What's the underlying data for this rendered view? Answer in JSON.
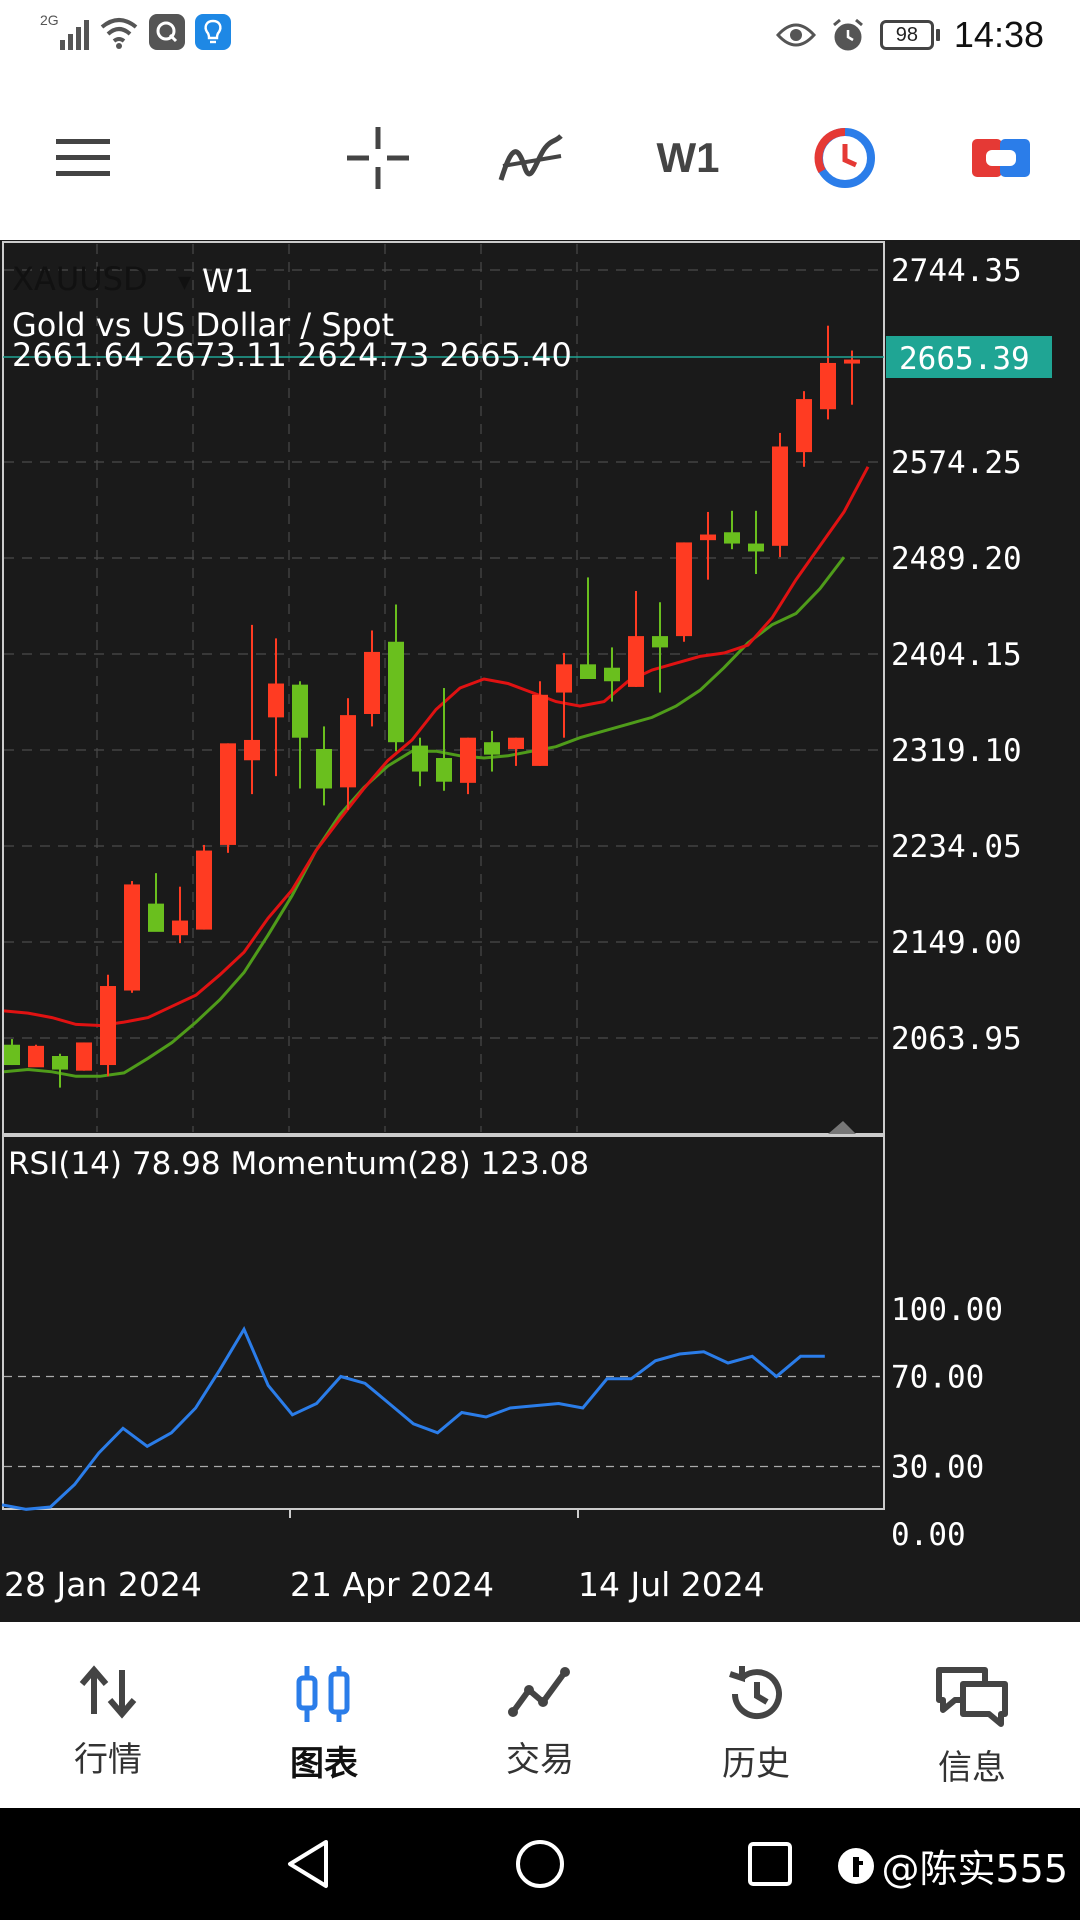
{
  "status_bar": {
    "network_label": "2G",
    "time": "14:38",
    "battery": "98",
    "icons": [
      "signal-icon",
      "wifi-icon",
      "app-icon",
      "bulb-icon",
      "eye-icon",
      "alarm-icon",
      "battery-icon"
    ]
  },
  "toolbar": {
    "timeframe": "W1",
    "icons": [
      "menu-icon",
      "crosshair-icon",
      "indicators-icon",
      "timeframe",
      "trade-clock-icon",
      "trade-toggle-icon"
    ]
  },
  "chart": {
    "symbol": "XAUUSD",
    "dropdown": "▾",
    "timeframe": "W1",
    "description": "Gold vs US Dollar / Spot",
    "ohlc": "2661.64 2673.11 2624.73 2665.40",
    "current_price": "2665.39",
    "price_labels": [
      "2744.35",
      "2574.25",
      "2489.20",
      "2404.15",
      "2319.10",
      "2234.05",
      "2149.00",
      "2063.95"
    ],
    "price_axis_values": [
      2744.35,
      2574.25,
      2489.2,
      2404.15,
      2319.1,
      2234.05,
      2149.0,
      2063.95
    ],
    "indicator_title": "RSI(14) 78.98 Momentum(28) 123.08",
    "rsi_labels": [
      "100.00",
      "70.00",
      "30.00",
      "0.00"
    ],
    "date_labels": [
      "28 Jan 2024",
      "21 Apr 2024",
      "14 Jul 2024"
    ],
    "colors": {
      "background": "#1a1a1a",
      "up_candle": "#ff3b22",
      "down_candle": "#6abf1e",
      "ma_fast": "#e01212",
      "ma_slow": "#4f9c1a",
      "rsi_line": "#2b7de9",
      "price_tag": "#1fa594"
    }
  },
  "chart_data": {
    "type": "candlestick",
    "candles": [
      {
        "o": 2058,
        "h": 2063,
        "l": 2040,
        "c": 2040
      },
      {
        "o": 2038,
        "h": 2058,
        "l": 2040,
        "c": 2057
      },
      {
        "o": 2048,
        "h": 2050,
        "l": 2020,
        "c": 2036
      },
      {
        "o": 2035,
        "h": 2060,
        "l": 2035,
        "c": 2060
      },
      {
        "o": 2040,
        "h": 2120,
        "l": 2030,
        "c": 2110
      },
      {
        "o": 2106,
        "h": 2203,
        "l": 2104,
        "c": 2200
      },
      {
        "o": 2183,
        "h": 2210,
        "l": 2164,
        "c": 2158
      },
      {
        "o": 2155,
        "h": 2198,
        "l": 2148,
        "c": 2168
      },
      {
        "o": 2160,
        "h": 2235,
        "l": 2160,
        "c": 2230
      },
      {
        "o": 2235,
        "h": 2325,
        "l": 2228,
        "c": 2325
      },
      {
        "o": 2310,
        "h": 2430,
        "l": 2280,
        "c": 2328
      },
      {
        "o": 2348,
        "h": 2418,
        "l": 2296,
        "c": 2378
      },
      {
        "o": 2377,
        "h": 2380,
        "l": 2285,
        "c": 2330
      },
      {
        "o": 2320,
        "h": 2340,
        "l": 2270,
        "c": 2285
      },
      {
        "o": 2286,
        "h": 2365,
        "l": 2266,
        "c": 2350
      },
      {
        "o": 2351,
        "h": 2425,
        "l": 2340,
        "c": 2406
      },
      {
        "o": 2415,
        "h": 2448,
        "l": 2318,
        "c": 2326
      },
      {
        "o": 2323,
        "h": 2330,
        "l": 2287,
        "c": 2300
      },
      {
        "o": 2312,
        "h": 2374,
        "l": 2283,
        "c": 2291
      },
      {
        "o": 2290,
        "h": 2330,
        "l": 2280,
        "c": 2330
      },
      {
        "o": 2326,
        "h": 2336,
        "l": 2300,
        "c": 2315
      },
      {
        "o": 2320,
        "h": 2330,
        "l": 2305,
        "c": 2330
      },
      {
        "o": 2305,
        "h": 2380,
        "l": 2305,
        "c": 2368
      },
      {
        "o": 2370,
        "h": 2405,
        "l": 2330,
        "c": 2395
      },
      {
        "o": 2395,
        "h": 2472,
        "l": 2382,
        "c": 2382
      },
      {
        "o": 2392,
        "h": 2410,
        "l": 2362,
        "c": 2380
      },
      {
        "o": 2375,
        "h": 2460,
        "l": 2375,
        "c": 2420
      },
      {
        "o": 2420,
        "h": 2450,
        "l": 2370,
        "c": 2410
      },
      {
        "o": 2420,
        "h": 2503,
        "l": 2415,
        "c": 2503
      },
      {
        "o": 2505,
        "h": 2530,
        "l": 2470,
        "c": 2510
      },
      {
        "o": 2512,
        "h": 2531,
        "l": 2497,
        "c": 2502
      },
      {
        "o": 2502,
        "h": 2531,
        "l": 2475,
        "c": 2495
      },
      {
        "o": 2500,
        "h": 2600,
        "l": 2490,
        "c": 2588
      },
      {
        "o": 2583,
        "h": 2637,
        "l": 2570,
        "c": 2630
      },
      {
        "o": 2621,
        "h": 2695,
        "l": 2612,
        "c": 2662
      },
      {
        "o": 2662,
        "h": 2673,
        "l": 2625,
        "c": 2665
      }
    ],
    "ma_fast": [
      2088,
      2086,
      2082,
      2076,
      2075,
      2078,
      2082,
      2092,
      2102,
      2120,
      2140,
      2170,
      2195,
      2230,
      2258,
      2285,
      2310,
      2328,
      2355,
      2374,
      2382,
      2378,
      2370,
      2362,
      2358,
      2362,
      2380,
      2390,
      2396,
      2402,
      2405,
      2412,
      2436,
      2470,
      2500,
      2530,
      2570
    ],
    "ma_slow": [
      2034,
      2036,
      2034,
      2030,
      2030,
      2033,
      2046,
      2060,
      2078,
      2098,
      2122,
      2155,
      2190,
      2230,
      2262,
      2286,
      2305,
      2318,
      2318,
      2314,
      2312,
      2314,
      2318,
      2322,
      2330,
      2336,
      2342,
      2348,
      2358,
      2372,
      2392,
      2414,
      2430,
      2440,
      2462,
      2490
    ],
    "rsi": [
      13,
      11,
      12,
      22,
      36,
      47,
      39,
      45,
      56,
      73,
      91,
      66,
      53,
      58,
      70,
      67,
      58,
      49,
      45,
      54,
      52,
      56,
      57,
      58,
      56,
      69,
      69,
      77,
      80,
      81,
      76,
      79,
      70,
      79,
      79
    ],
    "x_labels": [
      "28 Jan 2024",
      "21 Apr 2024",
      "14 Jul 2024"
    ],
    "ylim": [
      2000,
      2800
    ],
    "rsi_levels": [
      70,
      30
    ]
  },
  "bottom_nav": {
    "items": [
      {
        "label": "行情",
        "icon": "quotes-arrows-icon"
      },
      {
        "label": "图表",
        "icon": "chart-candles-icon"
      },
      {
        "label": "交易",
        "icon": "trade-line-icon"
      },
      {
        "label": "历史",
        "icon": "history-clock-icon"
      },
      {
        "label": "信息",
        "icon": "messages-icon"
      }
    ],
    "active_index": 1
  },
  "system_nav": {
    "watermark": "@陈实555"
  }
}
